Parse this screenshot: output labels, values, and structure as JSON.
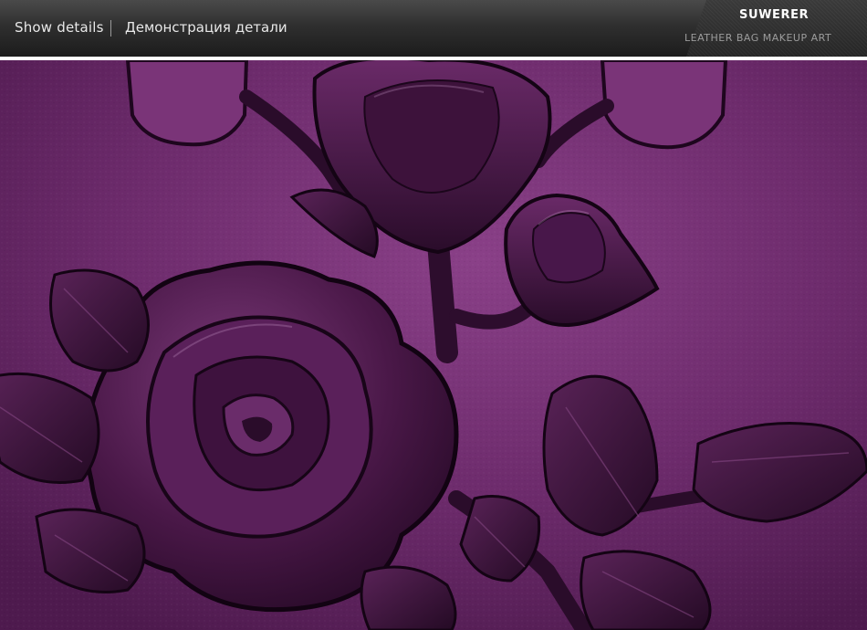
{
  "header": {
    "title_en": "Show details",
    "title_ru": "Демонстрация детали",
    "brand": "SUWERER",
    "tagline": "LEATHER BAG MAKEUP ART"
  },
  "photo": {
    "subject": "purple-leather-embossed-rose",
    "colors": {
      "leather": "#6e2d6e",
      "leather_light": "#8a4a8a",
      "emboss_dark": "#2a0d2a",
      "emboss_mid": "#4a1a4a"
    }
  }
}
